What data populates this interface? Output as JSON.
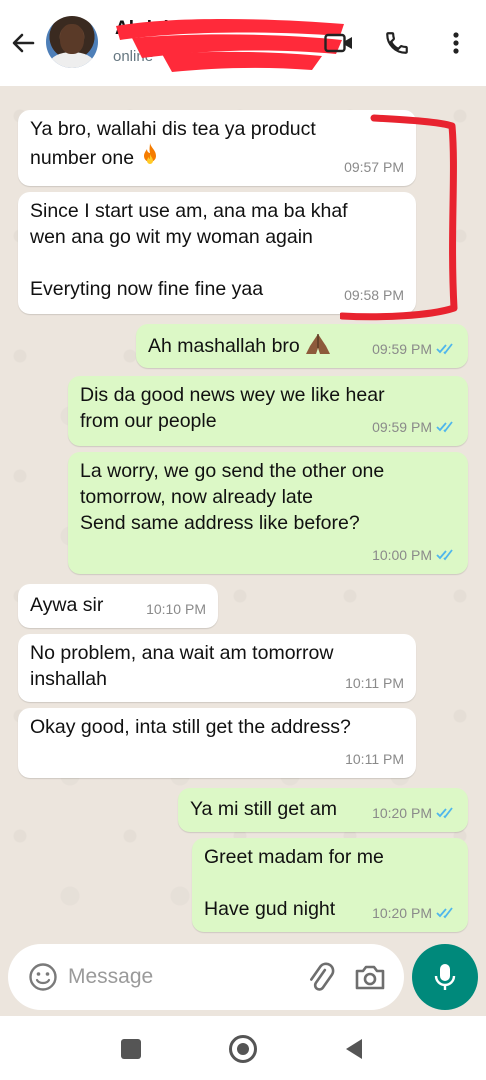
{
  "header": {
    "contact_name": "Abdul",
    "status": "online",
    "back_label": "Back",
    "redaction_color": "#ff2a3a"
  },
  "messages": [
    {
      "dir": "in",
      "text": "Ya bro, wallahi dis tea ya product\nnumber one",
      "emoji": "fire",
      "time": "09:57 PM"
    },
    {
      "dir": "in",
      "text": "Since I start use am, ana ma ba khaf\nwen ana go wit my woman again\n\nEveryting now fine fine yaa",
      "time": "09:58 PM"
    },
    {
      "dir": "out",
      "text": "Ah mashallah bro",
      "emoji": "folded-hands",
      "time": "09:59 PM",
      "read": true
    },
    {
      "dir": "out",
      "text": "Dis da good news wey we like hear\nfrom our people",
      "time": "09:59 PM",
      "read": true
    },
    {
      "dir": "out",
      "text": "La worry, we go send the other one\ntomorrow, now already late\nSend same address like before?",
      "time": "10:00 PM",
      "read": true
    },
    {
      "dir": "in",
      "text": "Aywa sir",
      "time": "10:10 PM"
    },
    {
      "dir": "in",
      "text": "No problem, ana wait am tomorrow\ninshallah",
      "time": "10:11 PM"
    },
    {
      "dir": "in",
      "text": "Okay good, inta still get the address?",
      "time": "10:11 PM"
    },
    {
      "dir": "out",
      "text": "Ya mi still get am",
      "time": "10:20 PM",
      "read": true
    },
    {
      "dir": "out",
      "text": "Greet madam for me\n\nHave gud night",
      "time": "10:20 PM",
      "read": true
    }
  ],
  "composer": {
    "placeholder": "Message"
  },
  "colors": {
    "incoming": "#ffffff",
    "outgoing": "#dcf8c6",
    "accent": "#00897b",
    "read_ticks": "#4fb6ec",
    "annotation": "#e8232f"
  },
  "icons": [
    "back-arrow-icon",
    "video-call-icon",
    "phone-icon",
    "more-vert-icon",
    "smiley-icon",
    "attach-icon",
    "camera-icon",
    "mic-icon",
    "nav-recents-icon",
    "nav-home-icon",
    "nav-back-icon"
  ]
}
